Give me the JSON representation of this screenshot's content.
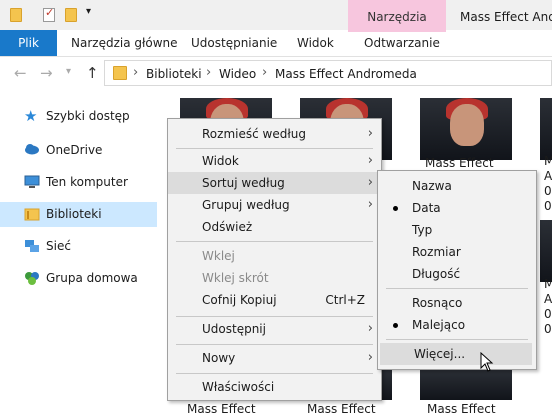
{
  "titlebar": {
    "contextual_tab": "Narzędzia wideo",
    "window_title": "Mass Effect Andro"
  },
  "ribbon": {
    "tabs": [
      "Plik",
      "Narzędzia główne",
      "Udostępnianie",
      "Widok",
      "Odtwarzanie"
    ]
  },
  "address": {
    "crumbs": [
      "Biblioteki",
      "Wideo",
      "Mass Effect Andromeda"
    ]
  },
  "nav": {
    "items": [
      "Szybki dostęp",
      "OneDrive",
      "Ten komputer",
      "Biblioteki",
      "Sieć",
      "Grupa domowa"
    ],
    "selected": "Biblioteki"
  },
  "files": {
    "labels": [
      "Mass Effect",
      "M",
      "A",
      "0",
      "0",
      "M",
      "A",
      "0",
      "0",
      "Mass Effect",
      "Mass Effect",
      "Mass Effect"
    ]
  },
  "context_menu": {
    "items": {
      "sort_by_size": "Rozmieść według",
      "view": "Widok",
      "sort_by": "Sortuj według",
      "group_by": "Grupuj według",
      "refresh": "Odśwież",
      "paste": "Wklej",
      "paste_shortcut": "Wklej skrót",
      "undo_copy": "Cofnij Kopiuj",
      "undo_shortcut": "Ctrl+Z",
      "share": "Udostępnij",
      "new": "Nowy",
      "properties": "Właściwości"
    }
  },
  "sort_submenu": {
    "items": {
      "name": "Nazwa",
      "date": "Data",
      "type": "Typ",
      "size": "Rozmiar",
      "length": "Długość",
      "ascending": "Rosnąco",
      "descending": "Malejąco",
      "more": "Więcej..."
    },
    "selected_field": "Data",
    "selected_order": "Malejąco"
  },
  "colors": {
    "accent": "#1979ca",
    "contextual_tab": "#f7c6de",
    "nav_selected": "#cce8ff"
  }
}
